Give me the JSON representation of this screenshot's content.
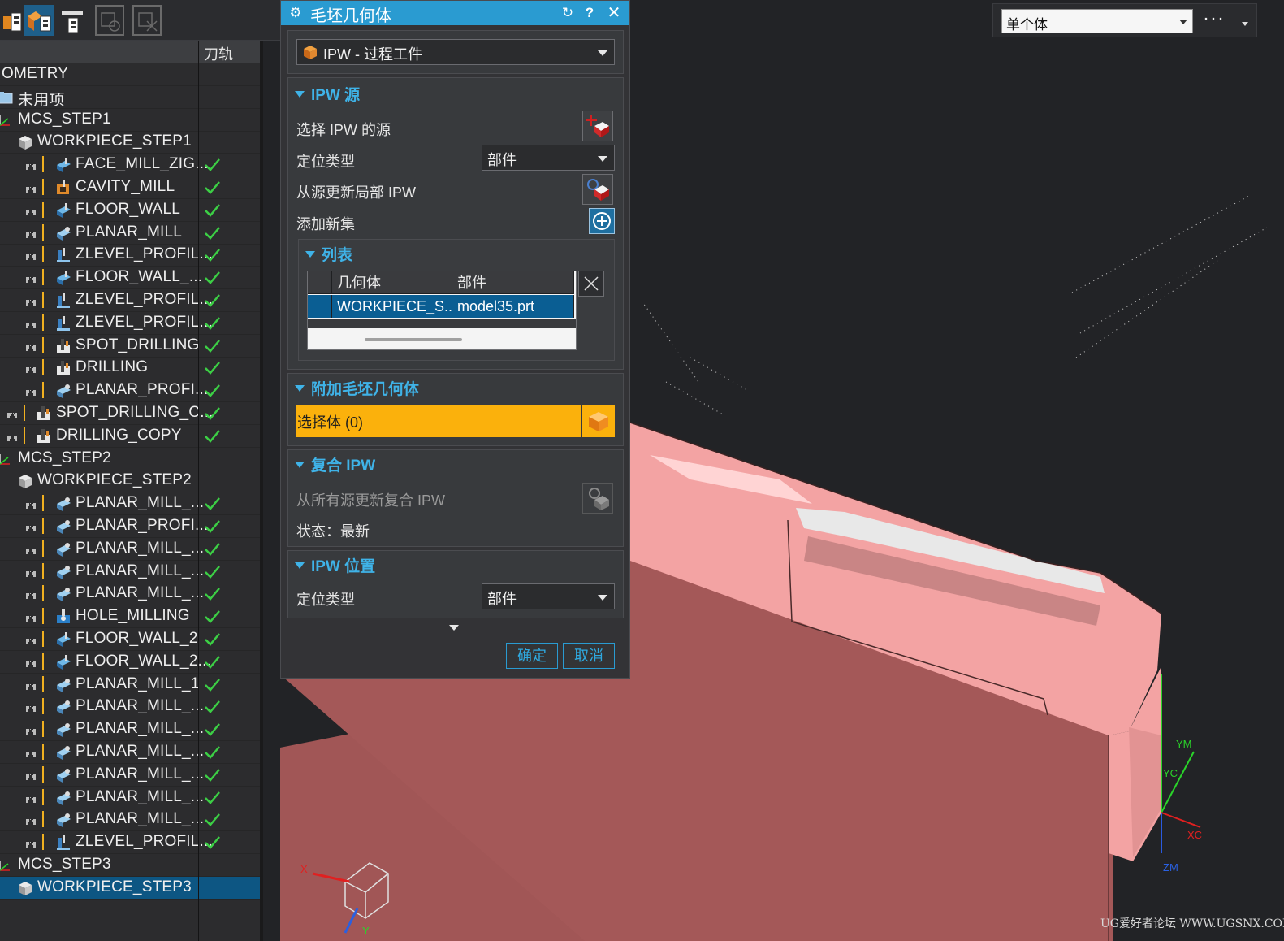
{
  "dialog": {
    "title": "毛坯几何体",
    "help_icon": "?",
    "type_value": "IPW - 过程工件",
    "sections": {
      "ipw_source": "IPW 源",
      "list": "列表",
      "additional_blank": "附加毛坯几何体",
      "composite_ipw": "复合 IPW",
      "ipw_position": "IPW 位置"
    },
    "select_ipw_source_label": "选择 IPW 的源",
    "positioning_type_label": "定位类型",
    "positioning_type_value": "部件",
    "update_local_ipw_label": "从源更新局部 IPW",
    "add_new_set_label": "添加新集",
    "list_columns": [
      "几何体",
      "部件"
    ],
    "list_rows": [
      {
        "geometry": "WORKPIECE_S...",
        "part": "model35.prt"
      }
    ],
    "select_body_label": "选择体 (0)",
    "update_composite_label": "从所有源更新复合 IPW",
    "status_label": "状态：最新",
    "position_type_label": "定位类型",
    "position_type_value": "部件",
    "ok_label": "确定",
    "cancel_label": "取消"
  },
  "navigator": {
    "column_toolpath": "刀轨",
    "rows": [
      {
        "label": "OMETRY",
        "check": false
      },
      {
        "label": "未用项",
        "check": false
      },
      {
        "label": "MCS_STEP1",
        "check": false
      },
      {
        "label": "WORKPIECE_STEP1",
        "check": false
      },
      {
        "label": "FACE_MILL_ZIG...",
        "check": true
      },
      {
        "label": "CAVITY_MILL",
        "check": true
      },
      {
        "label": "FLOOR_WALL",
        "check": true
      },
      {
        "label": "PLANAR_MILL",
        "check": true
      },
      {
        "label": "ZLEVEL_PROFIL...",
        "check": true
      },
      {
        "label": "FLOOR_WALL_...",
        "check": true
      },
      {
        "label": "ZLEVEL_PROFIL...",
        "check": true
      },
      {
        "label": "ZLEVEL_PROFIL...",
        "check": true
      },
      {
        "label": "SPOT_DRILLING",
        "check": true
      },
      {
        "label": "DRILLING",
        "check": true
      },
      {
        "label": "PLANAR_PROFI...",
        "check": true
      },
      {
        "label": "SPOT_DRILLING_C...",
        "check": true
      },
      {
        "label": "DRILLING_COPY",
        "check": true
      },
      {
        "label": "MCS_STEP2",
        "check": false
      },
      {
        "label": "WORKPIECE_STEP2",
        "check": false
      },
      {
        "label": "PLANAR_MILL_...",
        "check": true
      },
      {
        "label": "PLANAR_PROFI...",
        "check": true
      },
      {
        "label": "PLANAR_MILL_...",
        "check": true
      },
      {
        "label": "PLANAR_MILL_...",
        "check": true
      },
      {
        "label": "PLANAR_MILL_...",
        "check": true
      },
      {
        "label": "HOLE_MILLING",
        "check": true
      },
      {
        "label": "FLOOR_WALL_2",
        "check": true
      },
      {
        "label": "FLOOR_WALL_2...",
        "check": true
      },
      {
        "label": "PLANAR_MILL_1",
        "check": true
      },
      {
        "label": "PLANAR_MILL_...",
        "check": true
      },
      {
        "label": "PLANAR_MILL_...",
        "check": true
      },
      {
        "label": "PLANAR_MILL_...",
        "check": true
      },
      {
        "label": "PLANAR_MILL_...",
        "check": true
      },
      {
        "label": "PLANAR_MILL_...",
        "check": true
      },
      {
        "label": "PLANAR_MILL_...",
        "check": true
      },
      {
        "label": "ZLEVEL_PROFIL...",
        "check": true
      },
      {
        "label": "MCS_STEP3",
        "check": false
      },
      {
        "label": "WORKPIECE_STEP3",
        "check": false,
        "selected": true
      }
    ]
  },
  "filter": {
    "selection_value": "单个体",
    "more_label": "···"
  },
  "viewport": {
    "axis_labels": {
      "ym": "YM",
      "yc": "YC",
      "xc": "XC",
      "zm": "ZM",
      "x": "X",
      "y": "Y"
    }
  },
  "watermark": "UG爱好者论坛 WWW.UGSNX.COM",
  "colors": {
    "accent": "#2a9bd1",
    "section_header": "#3fb3e8",
    "select_body": "#fbb10c",
    "part_fill": "#f4a0a0",
    "check": "#3ccf45"
  }
}
